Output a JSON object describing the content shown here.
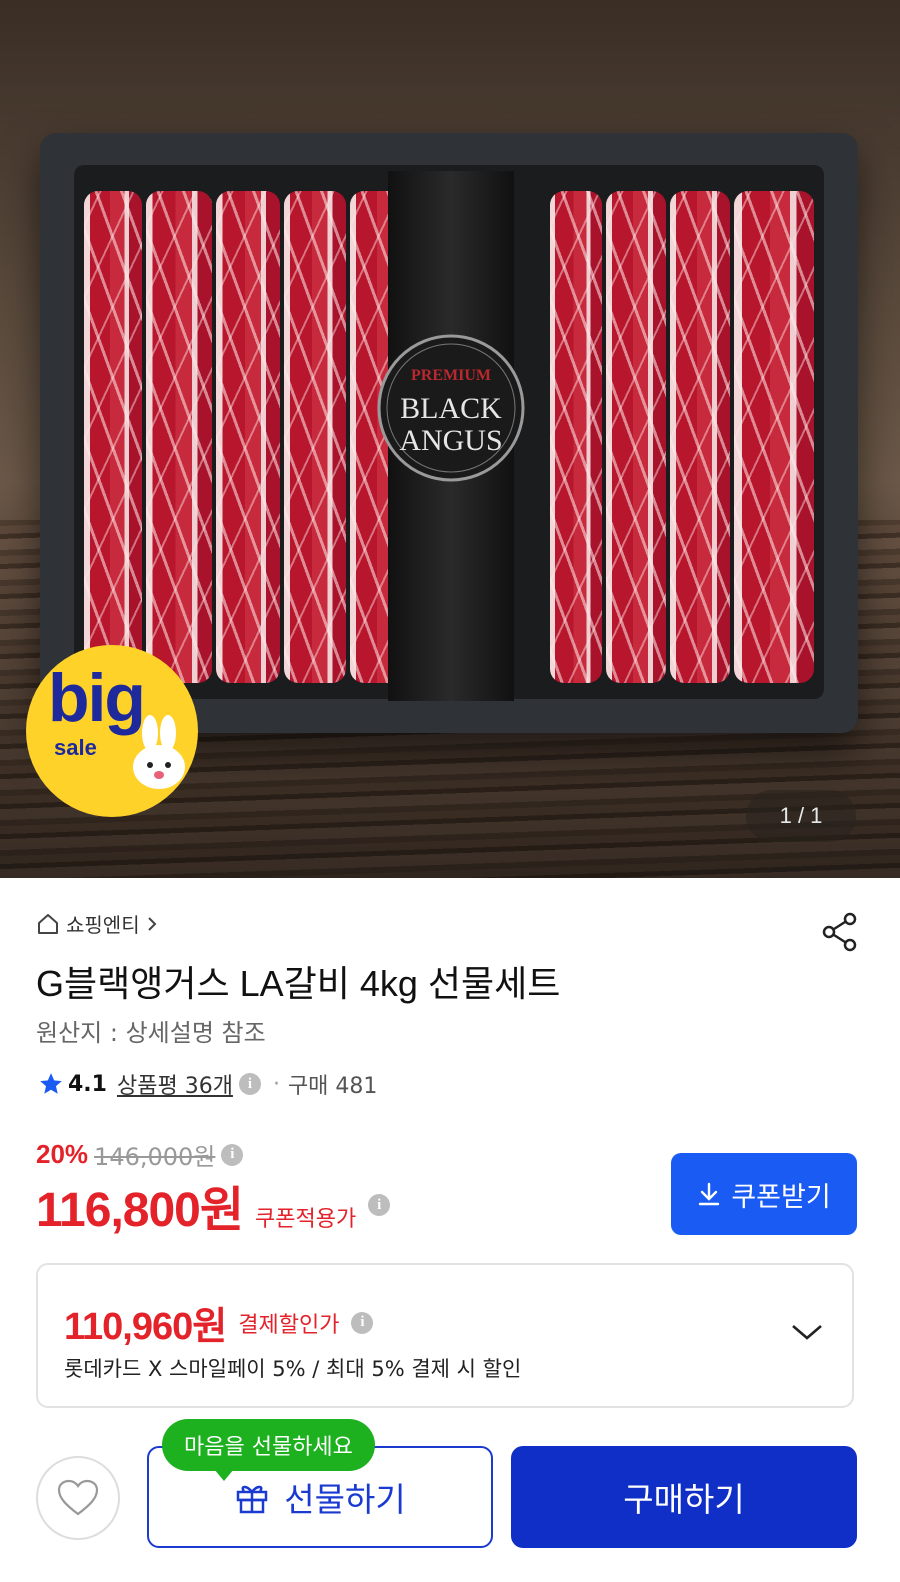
{
  "hero": {
    "pagination": "1 / 1",
    "band_top_text": "PREMIUM",
    "band_line1": "BLACK",
    "band_line2": "ANGUS",
    "badge_big": "big",
    "badge_sale": "sale"
  },
  "product": {
    "breadcrumb": "쇼핑엔티",
    "title": "G블랙앵거스 LA갈비 4kg 선물세트",
    "origin": "원산지 : 상세설명 참조",
    "rating": "4.1",
    "reviews": "상품평 36개",
    "purchases": "구매 481",
    "discount_rate": "20%",
    "original_price": "146,000원",
    "price": "116,800원",
    "price_label": "쿠폰적용가",
    "coupon_button": "쿠폰받기"
  },
  "payment": {
    "price": "110,960원",
    "label": "결제할인가",
    "description": "롯데카드 X 스마일페이 5%  / 최대 5% 결제 시 할인"
  },
  "bottom": {
    "tooltip": "마음을 선물하세요",
    "gift_button": "선물하기",
    "buy_button": "구매하기"
  },
  "colors": {
    "accent_red": "#e3222a",
    "coupon_blue": "#1a5cf3",
    "buy_blue": "#0f2fc7",
    "tooltip_green": "#1db01f"
  }
}
